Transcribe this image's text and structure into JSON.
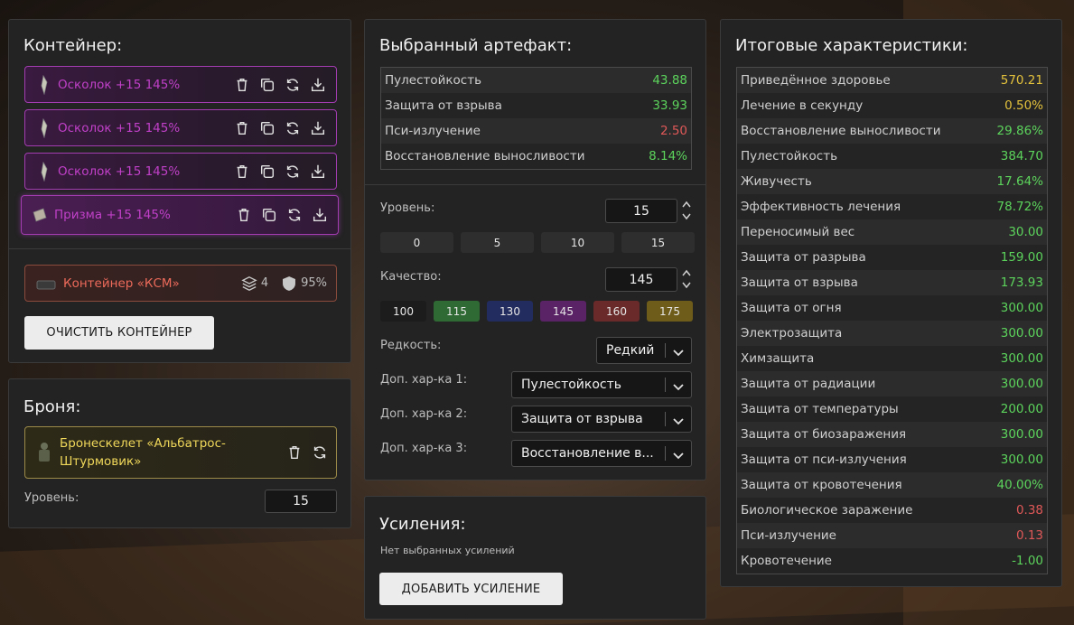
{
  "container": {
    "title": "Контейнер:",
    "slots": [
      {
        "label": "Осколок +15 145%"
      },
      {
        "label": "Осколок +15 145%"
      },
      {
        "label": "Осколок +15 145%"
      },
      {
        "label": "Призма +15 145%"
      }
    ],
    "card": {
      "label": "Контейнер «КСМ»",
      "slots_count": "4",
      "protection": "95%"
    },
    "clear_button": "ОЧИСТИТЬ КОНТЕЙНЕР"
  },
  "armor": {
    "title": "Броня:",
    "name_line1": "Бронескелет «Альбатрос-",
    "name_line2": "Штурмовик»",
    "level_label": "Уровень:",
    "level_value": "15"
  },
  "artifact": {
    "title": "Выбранный артефакт:",
    "stats": [
      {
        "name": "Пулестойкость",
        "value": "43.88",
        "color": "green"
      },
      {
        "name": "Защита от взрыва",
        "value": "33.93",
        "color": "green"
      },
      {
        "name": "Пси-излучение",
        "value": "2.50",
        "color": "red"
      },
      {
        "name": "Восстановление выносливости",
        "value": "8.14%",
        "color": "green"
      }
    ],
    "level_label": "Уровень:",
    "level_value": "15",
    "level_presets": [
      "0",
      "5",
      "10",
      "15"
    ],
    "quality_label": "Качество:",
    "quality_value": "145",
    "quality_presets": [
      {
        "label": "100",
        "color": "#1c1c1c"
      },
      {
        "label": "115",
        "color": "#2f6a34"
      },
      {
        "label": "130",
        "color": "#232c5e"
      },
      {
        "label": "145",
        "color": "#5a2366"
      },
      {
        "label": "160",
        "color": "#6a2a2a"
      },
      {
        "label": "175",
        "color": "#6e5c1a"
      }
    ],
    "rarity_label": "Редкость:",
    "rarity_value": "Редкий",
    "extra1_label": "Доп. хар-ка 1:",
    "extra1_value": "Пулестойкость",
    "extra2_label": "Доп. хар-ка 2:",
    "extra2_value": "Защита от взрыва",
    "extra3_label": "Доп. хар-ка 3:",
    "extra3_value": "Восстановление в..."
  },
  "boosts": {
    "title": "Усиления:",
    "empty_text": "Нет выбранных усилений",
    "add_button": "ДОБАВИТЬ УСИЛЕНИЕ"
  },
  "totals": {
    "title": "Итоговые характеристики:",
    "stats": [
      {
        "name": "Приведённое здоровье",
        "value": "570.21",
        "color": "yellow"
      },
      {
        "name": "Лечение в секунду",
        "value": "0.50%",
        "color": "yellow"
      },
      {
        "name": "Восстановление выносливости",
        "value": "29.86%",
        "color": "green"
      },
      {
        "name": "Пулестойкость",
        "value": "384.70",
        "color": "green"
      },
      {
        "name": "Живучесть",
        "value": "17.64%",
        "color": "green"
      },
      {
        "name": "Эффективность лечения",
        "value": "78.72%",
        "color": "green"
      },
      {
        "name": "Переносимый вес",
        "value": "30.00",
        "color": "green"
      },
      {
        "name": "Защита от разрыва",
        "value": "159.00",
        "color": "green"
      },
      {
        "name": "Защита от взрыва",
        "value": "173.93",
        "color": "green"
      },
      {
        "name": "Защита от огня",
        "value": "300.00",
        "color": "green"
      },
      {
        "name": "Электрозащита",
        "value": "300.00",
        "color": "green"
      },
      {
        "name": "Химзащита",
        "value": "300.00",
        "color": "green"
      },
      {
        "name": "Защита от радиации",
        "value": "300.00",
        "color": "green"
      },
      {
        "name": "Защита от температуры",
        "value": "200.00",
        "color": "green"
      },
      {
        "name": "Защита от биозаражения",
        "value": "300.00",
        "color": "green"
      },
      {
        "name": "Защита от пси-излучения",
        "value": "300.00",
        "color": "green"
      },
      {
        "name": "Защита от кровотечения",
        "value": "40.00%",
        "color": "green"
      },
      {
        "name": "Биологическое заражение",
        "value": "0.38",
        "color": "red"
      },
      {
        "name": "Пси-излучение",
        "value": "0.13",
        "color": "red"
      },
      {
        "name": "Кровотечение",
        "value": "-1.00",
        "color": "green"
      }
    ]
  }
}
